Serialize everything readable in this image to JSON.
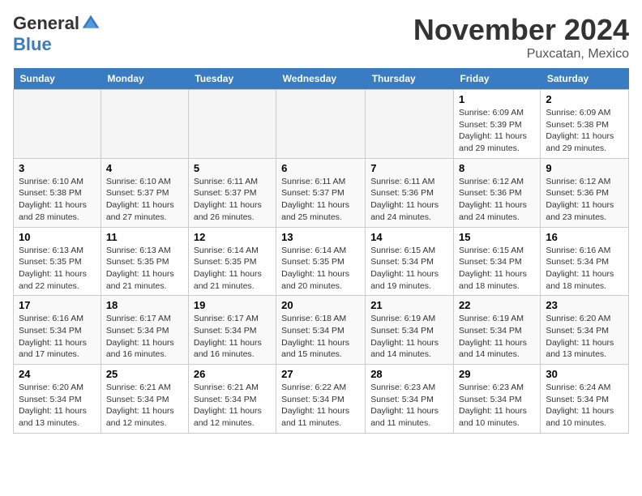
{
  "logo": {
    "general": "General",
    "blue": "Blue"
  },
  "header": {
    "month": "November 2024",
    "location": "Puxcatan, Mexico"
  },
  "days_of_week": [
    "Sunday",
    "Monday",
    "Tuesday",
    "Wednesday",
    "Thursday",
    "Friday",
    "Saturday"
  ],
  "weeks": [
    [
      {
        "day": "",
        "empty": true
      },
      {
        "day": "",
        "empty": true
      },
      {
        "day": "",
        "empty": true
      },
      {
        "day": "",
        "empty": true
      },
      {
        "day": "",
        "empty": true
      },
      {
        "day": "1",
        "sunrise": "6:09 AM",
        "sunset": "5:39 PM",
        "daylight": "11 hours and 29 minutes."
      },
      {
        "day": "2",
        "sunrise": "6:09 AM",
        "sunset": "5:38 PM",
        "daylight": "11 hours and 29 minutes."
      }
    ],
    [
      {
        "day": "3",
        "sunrise": "6:10 AM",
        "sunset": "5:38 PM",
        "daylight": "11 hours and 28 minutes."
      },
      {
        "day": "4",
        "sunrise": "6:10 AM",
        "sunset": "5:37 PM",
        "daylight": "11 hours and 27 minutes."
      },
      {
        "day": "5",
        "sunrise": "6:11 AM",
        "sunset": "5:37 PM",
        "daylight": "11 hours and 26 minutes."
      },
      {
        "day": "6",
        "sunrise": "6:11 AM",
        "sunset": "5:37 PM",
        "daylight": "11 hours and 25 minutes."
      },
      {
        "day": "7",
        "sunrise": "6:11 AM",
        "sunset": "5:36 PM",
        "daylight": "11 hours and 24 minutes."
      },
      {
        "day": "8",
        "sunrise": "6:12 AM",
        "sunset": "5:36 PM",
        "daylight": "11 hours and 24 minutes."
      },
      {
        "day": "9",
        "sunrise": "6:12 AM",
        "sunset": "5:36 PM",
        "daylight": "11 hours and 23 minutes."
      }
    ],
    [
      {
        "day": "10",
        "sunrise": "6:13 AM",
        "sunset": "5:35 PM",
        "daylight": "11 hours and 22 minutes."
      },
      {
        "day": "11",
        "sunrise": "6:13 AM",
        "sunset": "5:35 PM",
        "daylight": "11 hours and 21 minutes."
      },
      {
        "day": "12",
        "sunrise": "6:14 AM",
        "sunset": "5:35 PM",
        "daylight": "11 hours and 21 minutes."
      },
      {
        "day": "13",
        "sunrise": "6:14 AM",
        "sunset": "5:35 PM",
        "daylight": "11 hours and 20 minutes."
      },
      {
        "day": "14",
        "sunrise": "6:15 AM",
        "sunset": "5:34 PM",
        "daylight": "11 hours and 19 minutes."
      },
      {
        "day": "15",
        "sunrise": "6:15 AM",
        "sunset": "5:34 PM",
        "daylight": "11 hours and 18 minutes."
      },
      {
        "day": "16",
        "sunrise": "6:16 AM",
        "sunset": "5:34 PM",
        "daylight": "11 hours and 18 minutes."
      }
    ],
    [
      {
        "day": "17",
        "sunrise": "6:16 AM",
        "sunset": "5:34 PM",
        "daylight": "11 hours and 17 minutes."
      },
      {
        "day": "18",
        "sunrise": "6:17 AM",
        "sunset": "5:34 PM",
        "daylight": "11 hours and 16 minutes."
      },
      {
        "day": "19",
        "sunrise": "6:17 AM",
        "sunset": "5:34 PM",
        "daylight": "11 hours and 16 minutes."
      },
      {
        "day": "20",
        "sunrise": "6:18 AM",
        "sunset": "5:34 PM",
        "daylight": "11 hours and 15 minutes."
      },
      {
        "day": "21",
        "sunrise": "6:19 AM",
        "sunset": "5:34 PM",
        "daylight": "11 hours and 14 minutes."
      },
      {
        "day": "22",
        "sunrise": "6:19 AM",
        "sunset": "5:34 PM",
        "daylight": "11 hours and 14 minutes."
      },
      {
        "day": "23",
        "sunrise": "6:20 AM",
        "sunset": "5:34 PM",
        "daylight": "11 hours and 13 minutes."
      }
    ],
    [
      {
        "day": "24",
        "sunrise": "6:20 AM",
        "sunset": "5:34 PM",
        "daylight": "11 hours and 13 minutes."
      },
      {
        "day": "25",
        "sunrise": "6:21 AM",
        "sunset": "5:34 PM",
        "daylight": "11 hours and 12 minutes."
      },
      {
        "day": "26",
        "sunrise": "6:21 AM",
        "sunset": "5:34 PM",
        "daylight": "11 hours and 12 minutes."
      },
      {
        "day": "27",
        "sunrise": "6:22 AM",
        "sunset": "5:34 PM",
        "daylight": "11 hours and 11 minutes."
      },
      {
        "day": "28",
        "sunrise": "6:23 AM",
        "sunset": "5:34 PM",
        "daylight": "11 hours and 11 minutes."
      },
      {
        "day": "29",
        "sunrise": "6:23 AM",
        "sunset": "5:34 PM",
        "daylight": "11 hours and 10 minutes."
      },
      {
        "day": "30",
        "sunrise": "6:24 AM",
        "sunset": "5:34 PM",
        "daylight": "11 hours and 10 minutes."
      }
    ]
  ]
}
